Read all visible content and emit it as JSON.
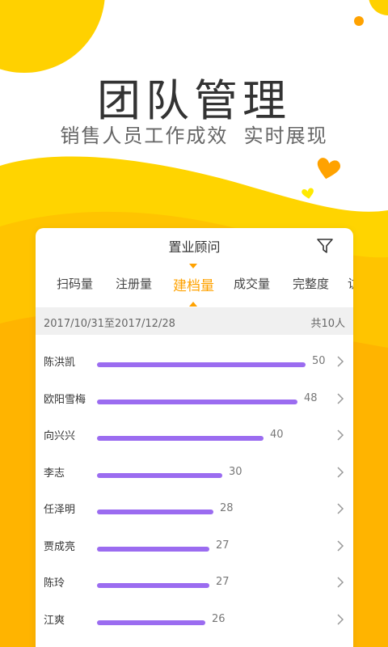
{
  "banner": {
    "title": "团队管理",
    "subtitle": "销售人员工作成效  实时展现"
  },
  "card": {
    "title": "置业顾问",
    "tabs": [
      "扫码量",
      "注册量",
      "建档量",
      "成交量",
      "完整度",
      "访"
    ],
    "active_tab": "建档量",
    "date_range": "2017/10/31至2017/12/28",
    "total": "共10人"
  },
  "chart_data": {
    "type": "bar",
    "orientation": "horizontal",
    "categories": [
      "陈洪凯",
      "欧阳雪梅",
      "向兴兴",
      "李志",
      "任泽明",
      "贾成亮",
      "陈玲",
      "江爽"
    ],
    "values": [
      50,
      48,
      40,
      30,
      28,
      27,
      27,
      26
    ],
    "value_labels": [
      "50",
      "48",
      "40",
      "30",
      "28",
      "27",
      "27",
      "26"
    ],
    "bar_color": "#9b6cf0"
  },
  "colors": {
    "accent": "#ffa200",
    "yellow": "#ffd100",
    "bar": "#9b6cf0"
  },
  "icons": {
    "filter": "filter-funnel-icon",
    "row_action": "chevron-right-icon",
    "decor": "heart-icon"
  }
}
